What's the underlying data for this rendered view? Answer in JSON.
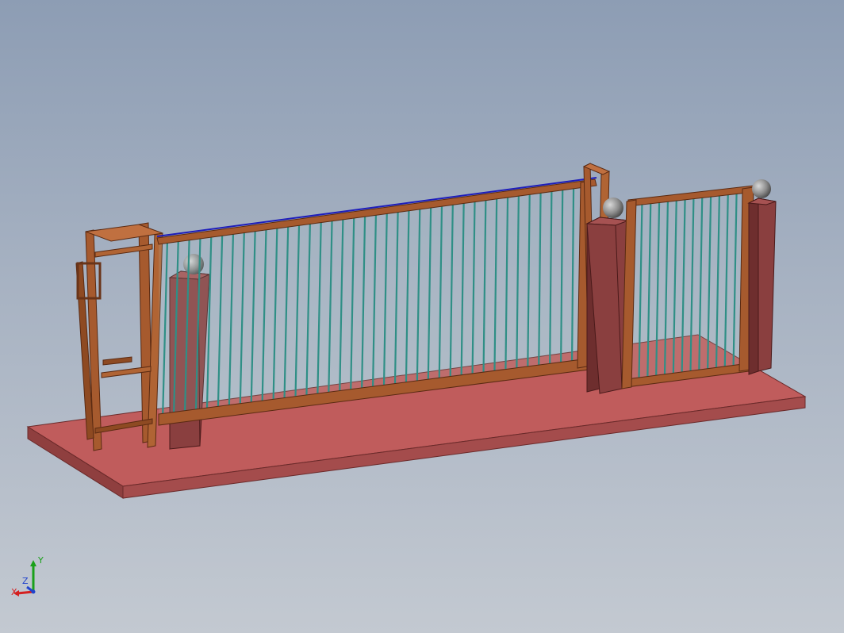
{
  "viewport": {
    "background_top": "#8d9db4",
    "background_bottom": "#c3c9d1",
    "model_colors": {
      "base_slab": "#c05c5c",
      "pillar": "#8a3f3f",
      "frame": "#a65a2e",
      "bars": "#2f8f86",
      "rail": "#1d1dbb",
      "caps": "#9a9a9a"
    }
  },
  "triad": {
    "x_label": "X",
    "y_label": "Y",
    "z_label": "Z",
    "x_color": "#d42020",
    "y_color": "#1aa01a",
    "z_color": "#2244cc"
  }
}
